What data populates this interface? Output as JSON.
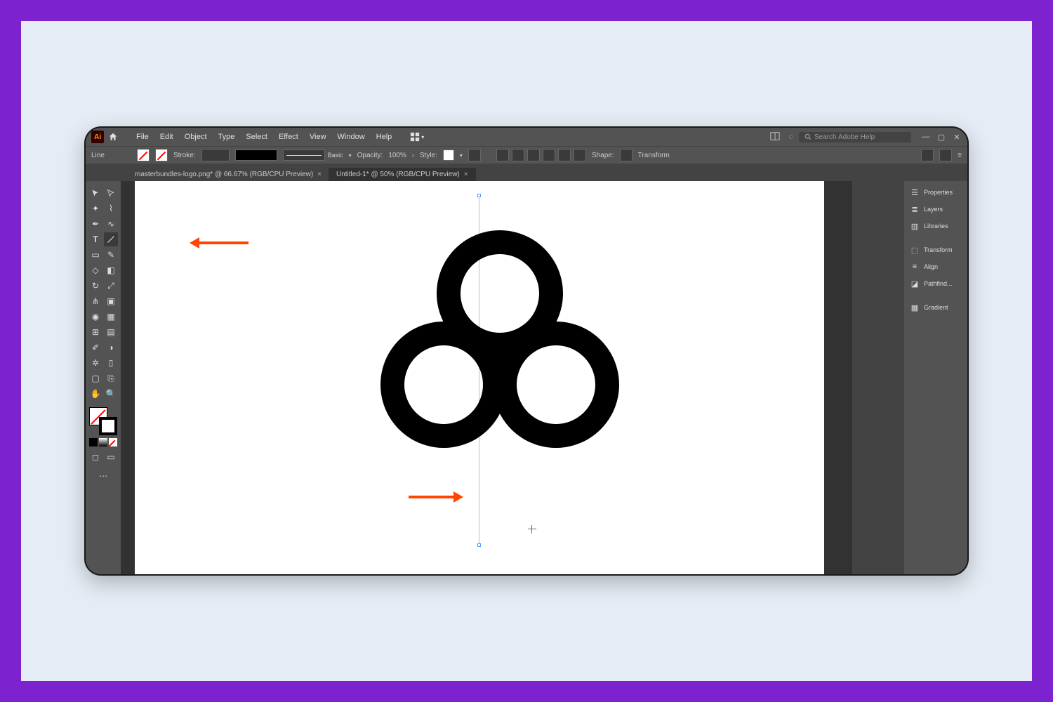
{
  "menubar": {
    "items": [
      "File",
      "Edit",
      "Object",
      "Type",
      "Select",
      "Effect",
      "View",
      "Window",
      "Help"
    ],
    "search_placeholder": "Search Adobe Help"
  },
  "optionbar": {
    "tool_label": "Line",
    "stroke_label": "Stroke:",
    "brush_label": "Basic",
    "opacity_label": "Opacity:",
    "opacity_value": "100%",
    "style_label": "Style:",
    "shape_label": "Shape:",
    "transform_label": "Transform"
  },
  "tabs": [
    {
      "label": "masterbundles-logo.png* @ 66.67% (RGB/CPU Preview)",
      "active": false
    },
    {
      "label": "Untitled-1* @ 50% (RGB/CPU Preview)",
      "active": true
    }
  ],
  "right_panels": {
    "group1": [
      {
        "icon": "sliders",
        "label": "Properties"
      },
      {
        "icon": "layers",
        "label": "Layers"
      },
      {
        "icon": "book",
        "label": "Libraries"
      }
    ],
    "group2": [
      {
        "icon": "transform",
        "label": "Transform"
      },
      {
        "icon": "align",
        "label": "Align"
      },
      {
        "icon": "pathfinder",
        "label": "Pathfind..."
      }
    ],
    "group3": [
      {
        "icon": "gradient",
        "label": "Gradient"
      }
    ]
  },
  "annotations": {
    "arrow1_target": "line-segment-tool",
    "arrow2_target": "vertical-guide-line"
  }
}
